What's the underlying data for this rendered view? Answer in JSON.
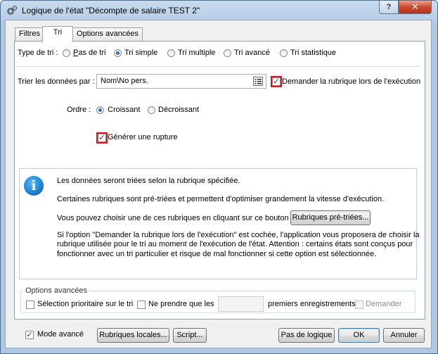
{
  "window": {
    "title": "Logique de l'état \"Décompte de salaire TEST 2\"",
    "help_label": "?",
    "close_label": "✕"
  },
  "tabs": [
    {
      "label": "Filtres"
    },
    {
      "label": "Tri"
    },
    {
      "label": "Options avancées"
    }
  ],
  "sort_type": {
    "label": "Type de tri :",
    "options": [
      {
        "label": "Pas de tri",
        "checked": false
      },
      {
        "label": "Tri simple",
        "checked": true
      },
      {
        "label": "Tri multiple",
        "checked": false
      },
      {
        "label": "Tri avancé",
        "checked": false
      },
      {
        "label": "Tri statistique",
        "checked": false
      }
    ]
  },
  "sort_by": {
    "label": "Trier les données par :",
    "value": "Nom\\No pers.",
    "ask_label": "Demander la rubrique lors de l'exécution",
    "ask_checked": true
  },
  "order": {
    "label": "Ordre :",
    "options": [
      {
        "label": "Croissant",
        "checked": true
      },
      {
        "label": "Décroissant",
        "checked": false
      }
    ]
  },
  "break": {
    "label": "Générer une rupture",
    "checked": true
  },
  "info": {
    "line1": "Les données seront triées selon la rubrique spécifiée.",
    "line2": "Certaines rubriques sont pré-triées et permettent d'optimiser grandement la vitesse d'exécution.",
    "line3": "Vous pouvez choisir une de ces rubriques en cliquant sur ce bouton :",
    "presorted_button": "Rubriques pré-triées...",
    "note1": "Si l'option \"Demander la rubrique lors de l'exécution\" est cochée, l'application vous proposera de choisir la",
    "note2": "rubrique utilisée pour le tri au moment de l'exécution de l'état. Attention : certains états sont conçus pour",
    "note3": "fonctionner avec un tri particulier et risque de mal fonctionner si cette option est sélectionnée."
  },
  "advanced": {
    "legend": "Options avancées",
    "priority_label": "Sélection prioritaire sur le tri",
    "priority_checked": false,
    "limit_label": "Ne prendre que les",
    "limit_checked": false,
    "limit_value": "",
    "limit_suffix": "premiers enregistrements.",
    "ask_label": "Demander",
    "ask_checked": false
  },
  "footer": {
    "advanced_mode_label": "Mode avancé",
    "advanced_mode_checked": true,
    "local_fields_button": "Rubriques locales...",
    "script_button": "Script...",
    "no_logic_button": "Pas de logique",
    "ok_button": "OK",
    "cancel_button": "Annuler"
  }
}
